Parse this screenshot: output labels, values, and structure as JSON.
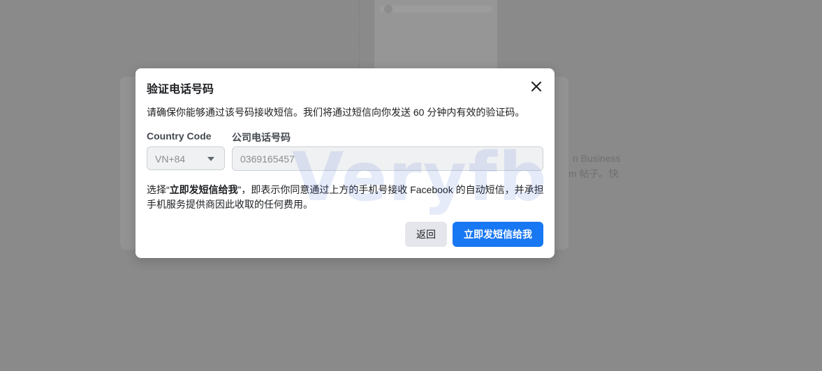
{
  "background": {
    "text_line1": "n Business",
    "text_line2": "m 帖子。快"
  },
  "modal": {
    "title": "验证电话号码",
    "description": "请确保你能够通过该号码接收短信。我们将通过短信向你发送 60 分钟内有效的验证码。",
    "country_code_label": "Country Code",
    "country_code_value": "VN+84",
    "phone_label": "公司电话号码",
    "phone_value": "0369165457",
    "consent_prefix": "选择“",
    "consent_bold": "立即发短信给我",
    "consent_suffix": "”，即表示你同意通过上方的手机号接收 Facebook 的自动短信，并承担手机服务提供商因此收取的任何费用。",
    "back_label": "返回",
    "send_label": "立即发短信给我"
  },
  "watermark": "Veryfb",
  "colors": {
    "primary": "#1877f2",
    "overlay": "#8a8a8a"
  }
}
